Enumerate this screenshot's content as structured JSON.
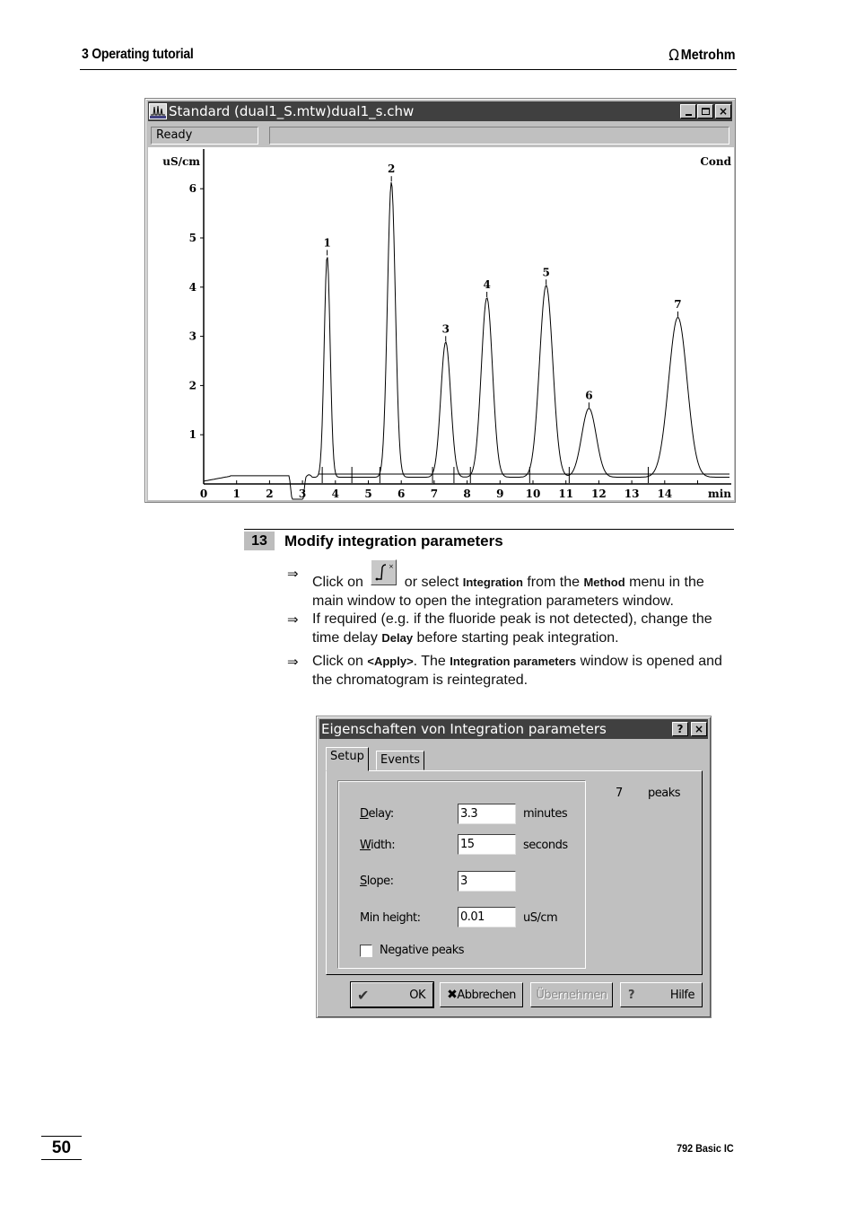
{
  "header": {
    "section_title": "3  Operating tutorial",
    "brand": "Metrohm",
    "brand_icon": "omega-icon"
  },
  "chromatogram_window": {
    "title": "Standard (dual1_S.mtw)dual1_s.chw",
    "app_icon": "chromatogram-icon",
    "controls": {
      "minimize": "_",
      "maximize": "□",
      "close": "×"
    },
    "status_left": "Ready",
    "status_right": ""
  },
  "chart_data": {
    "type": "line",
    "title": "",
    "xlabel": "min",
    "ylabel": "uS/cm",
    "channel_label": "Cond",
    "xlim": [
      0,
      16
    ],
    "ylim": [
      0,
      6.6
    ],
    "x_ticks": [
      0,
      1,
      2,
      3,
      4,
      5,
      6,
      7,
      8,
      9,
      10,
      11,
      12,
      13,
      14
    ],
    "y_ticks": [
      1,
      2,
      3,
      4,
      5,
      6
    ],
    "grid": false,
    "baseline_level": 0.1,
    "peaks": [
      {
        "label": "1",
        "time": 3.75,
        "height": 4.5,
        "width": 0.09
      },
      {
        "label": "2",
        "time": 5.7,
        "height": 6.0,
        "width": 0.12
      },
      {
        "label": "3",
        "time": 7.35,
        "height": 2.75,
        "width": 0.15
      },
      {
        "label": "4",
        "time": 8.6,
        "height": 3.65,
        "width": 0.17
      },
      {
        "label": "5",
        "time": 10.4,
        "height": 3.9,
        "width": 0.2
      },
      {
        "label": "6",
        "time": 11.7,
        "height": 1.4,
        "width": 0.22
      },
      {
        "label": "7",
        "time": 14.4,
        "height": 3.25,
        "width": 0.28
      }
    ],
    "integration_marks": [
      3.6,
      4.5,
      5.35,
      6.95,
      7.6,
      8.1,
      9.9,
      11.1,
      13.5
    ]
  },
  "step": {
    "number": "13",
    "title": "Modify integration parameters",
    "bullets": [
      {
        "arrow": "⇒",
        "parts": [
          "Click on ",
          "integration-button-icon",
          " or select ",
          "Integration",
          " from the ",
          "Method",
          " menu in the main window to open the integration parameters window."
        ]
      },
      {
        "arrow": "⇒",
        "parts": [
          "If required (e.g. if the fluoride peak is not detected), change the time delay ",
          "Delay",
          " before starting peak integration."
        ]
      },
      {
        "arrow": "⇒",
        "parts": [
          "Click on ",
          "<Apply>",
          ". The ",
          "Integration parameters",
          " window is opened and the chromatogram is reintegrated."
        ]
      }
    ]
  },
  "dialog": {
    "title": "Eigenschaften von Integration parameters",
    "help_btn": "?",
    "close_btn": "×",
    "tabs": [
      "Setup",
      "Events"
    ],
    "active_tab": "Setup",
    "fields": [
      {
        "label": "Delay:",
        "value": "3.3",
        "unit": "minutes"
      },
      {
        "label": "Width:",
        "value": "15",
        "unit": "seconds"
      },
      {
        "label": "Slope:",
        "value": "3",
        "unit": ""
      },
      {
        "label": "Min height:",
        "value": "0.01",
        "unit": "uS/cm"
      }
    ],
    "negative_peaks": {
      "label": "Negative peaks",
      "checked": false
    },
    "peaks_count": "7",
    "peaks_label": "peaks",
    "buttons": {
      "ok": "OK",
      "cancel": "Abbrechen",
      "apply": "Übernehmen",
      "help": "Hilfe"
    }
  },
  "footer": {
    "page_number": "50",
    "product": "792 Basic IC"
  }
}
